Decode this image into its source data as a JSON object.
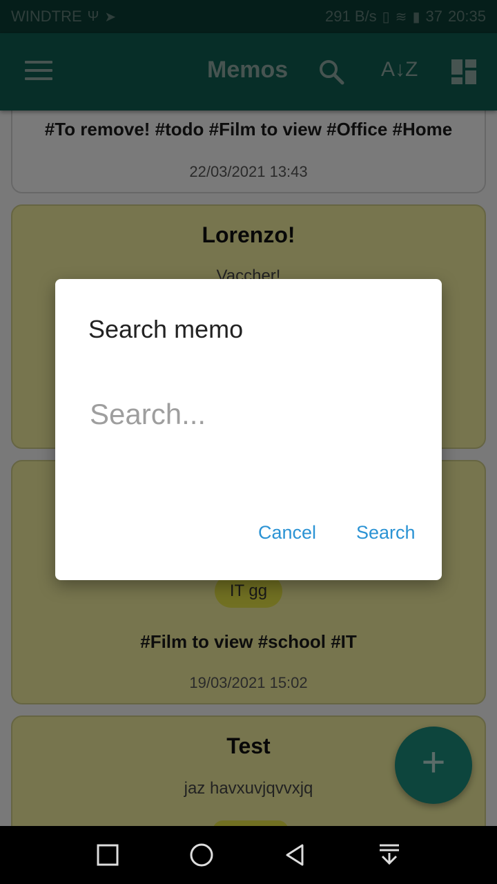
{
  "status_bar": {
    "carrier": "WINDTRE",
    "speed": "291 B/s",
    "battery": "37",
    "time": "20:35"
  },
  "app_bar": {
    "title": "Memos",
    "icons": [
      "menu-icon",
      "search-icon",
      "sort-az-icon",
      "dashboard-layout-icon"
    ]
  },
  "memos": [
    {
      "tags": "#To remove! #todo #Film to view  #Office #Home",
      "date": "22/03/2021 13:43"
    },
    {
      "title": "Lorenzo!",
      "body": "Vaccher!"
    },
    {
      "chip": "IT gg",
      "tags": "#Film to view  #school #IT",
      "date": "19/03/2021 15:02"
    },
    {
      "title": "Test",
      "body": "jaz havxuvjqvvxjq"
    }
  ],
  "dialog": {
    "title": "Search memo",
    "input_placeholder": "Search...",
    "cancel_label": "Cancel",
    "search_label": "Search"
  },
  "fab": {
    "label": "+"
  },
  "colors": {
    "app_bar": "#0f5c50",
    "accent": "#1a8a7a",
    "memo_yellow": "#eeeb9c",
    "dialog_button": "#2b93d4"
  }
}
